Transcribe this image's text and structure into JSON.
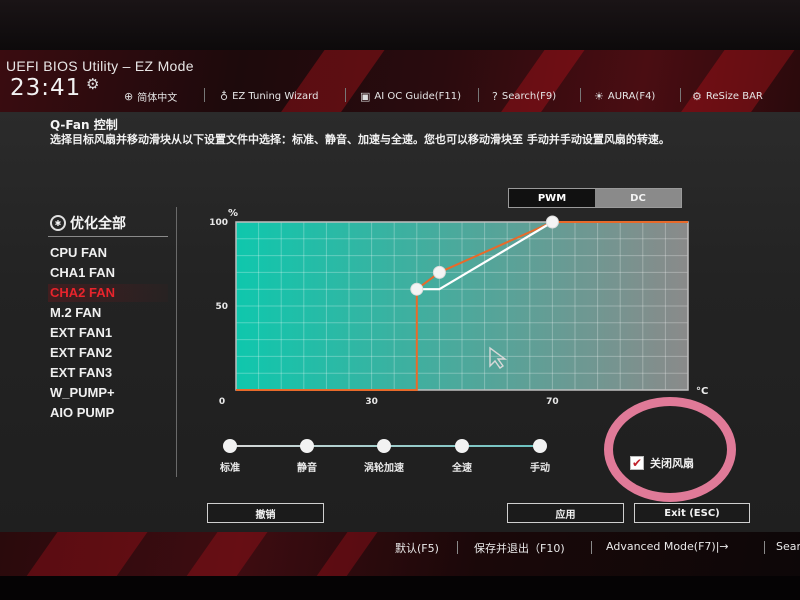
{
  "app_title": "UEFI BIOS Utility – EZ Mode",
  "clock": "23:41",
  "toolbar": [
    {
      "icon": "globe-icon",
      "label": "简体中文"
    },
    {
      "icon": "lightbulb-icon",
      "label": "EZ Tuning Wizard"
    },
    {
      "icon": "chip-icon",
      "label": "AI OC Guide(F11)"
    },
    {
      "icon": "help-icon",
      "label": "Search(F9)"
    },
    {
      "icon": "aura-icon",
      "label": "AURA(F4)"
    },
    {
      "icon": "resize-bar-icon",
      "label": "ReSize BAR"
    }
  ],
  "panel": {
    "title": "Q-Fan 控制",
    "description": "选择目标风扇并移动滑块从以下设置文件中选择：标准、静音、加速与全速。您也可以移动滑块至 手动并手动设置风扇的转速。"
  },
  "mode_toggle": {
    "pwm": "PWM",
    "dc": "DC",
    "selected": "PWM"
  },
  "sidebar": {
    "title": "优化全部",
    "items": [
      "CPU FAN",
      "CHA1 FAN",
      "CHA2 FAN",
      "M.2 FAN",
      "EXT FAN1",
      "EXT FAN2",
      "EXT FAN3",
      "W_PUMP+",
      "AIO PUMP"
    ],
    "selected": "CHA2 FAN"
  },
  "chart_data": {
    "type": "line",
    "title": "",
    "xlabel": "°C",
    "ylabel": "%",
    "xlim": [
      0,
      100
    ],
    "ylim": [
      0,
      100
    ],
    "x_ticks": [
      0,
      30,
      70
    ],
    "y_ticks": [
      50,
      100
    ],
    "grid": true,
    "series": [
      {
        "color": "#e86a2a",
        "x": [
          0,
          40,
          40,
          45,
          70,
          100
        ],
        "y": [
          0,
          0,
          60,
          70,
          100,
          100
        ]
      },
      {
        "color": "#ffffff",
        "x": [
          40,
          45,
          70
        ],
        "y": [
          60,
          60,
          100
        ]
      }
    ],
    "points": [
      {
        "x": 40,
        "y": 60
      },
      {
        "x": 45,
        "y": 70
      },
      {
        "x": 70,
        "y": 100
      }
    ],
    "area_gradient": [
      "#0fc7ad",
      "#8a8a8a"
    ],
    "border_color": "#e86a2a"
  },
  "presets": {
    "items": [
      "标准",
      "静音",
      "涡轮加速",
      "全速",
      "手动"
    ]
  },
  "close_fan": {
    "label": "关闭风扇",
    "checked": true
  },
  "buttons": {
    "undo": "撤销",
    "apply": "应用",
    "exit": "Exit (ESC)"
  },
  "footer": [
    "默认(F5)",
    "保存并退出（F10)",
    "Advanced Mode(F7)|→",
    "Sear"
  ],
  "colors": {
    "accent": "#e8242c",
    "highlight_ring": "#e07a98"
  }
}
